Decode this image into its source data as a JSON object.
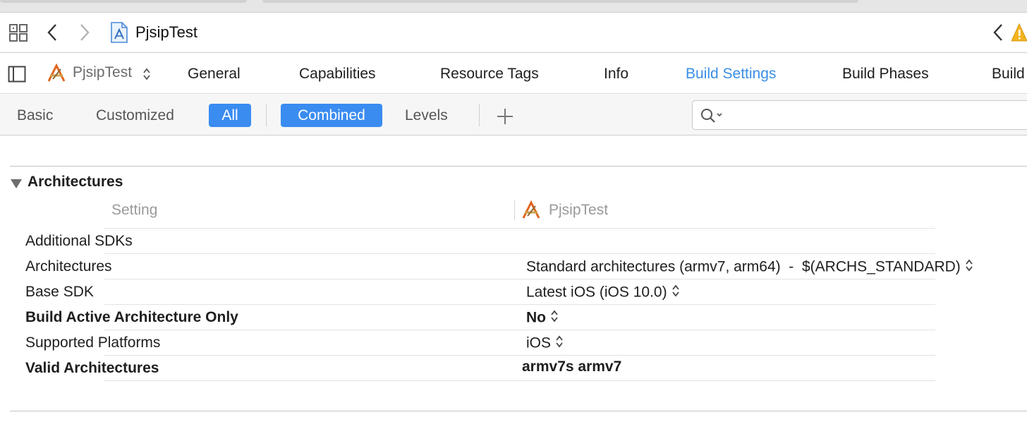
{
  "jumpbar": {
    "file_name": "PjsipTest"
  },
  "tabbar": {
    "target_name": "PjsipTest",
    "tabs": [
      {
        "label": "General"
      },
      {
        "label": "Capabilities"
      },
      {
        "label": "Resource Tags"
      },
      {
        "label": "Info"
      },
      {
        "label": "Build Settings"
      },
      {
        "label": "Build Phases"
      },
      {
        "label": "Build"
      }
    ],
    "active_tab": "Build Settings",
    "accent_color": "#3a8ee6"
  },
  "filterbar": {
    "scope_basic": "Basic",
    "scope_customized": "Customized",
    "scope_all": "All",
    "view_combined": "Combined",
    "view_levels": "Levels",
    "search_value": "",
    "toggle_color": "#3a8cf1"
  },
  "section": {
    "title": "Architectures",
    "col_setting": "Setting",
    "col_target": "PjsipTest",
    "rows": [
      {
        "setting": "Additional SDKs",
        "value": ""
      },
      {
        "setting": "Architectures",
        "value": "Standard architectures (armv7, arm64)  -  $(ARCHS_STANDARD)"
      },
      {
        "setting": "Base SDK",
        "value": "Latest iOS (iOS 10.0)"
      },
      {
        "setting": "Build Active Architecture Only",
        "value": "No"
      },
      {
        "setting": "Supported Platforms",
        "value": "iOS"
      },
      {
        "setting": "Valid Architectures",
        "value": "armv7s armv7"
      }
    ]
  }
}
